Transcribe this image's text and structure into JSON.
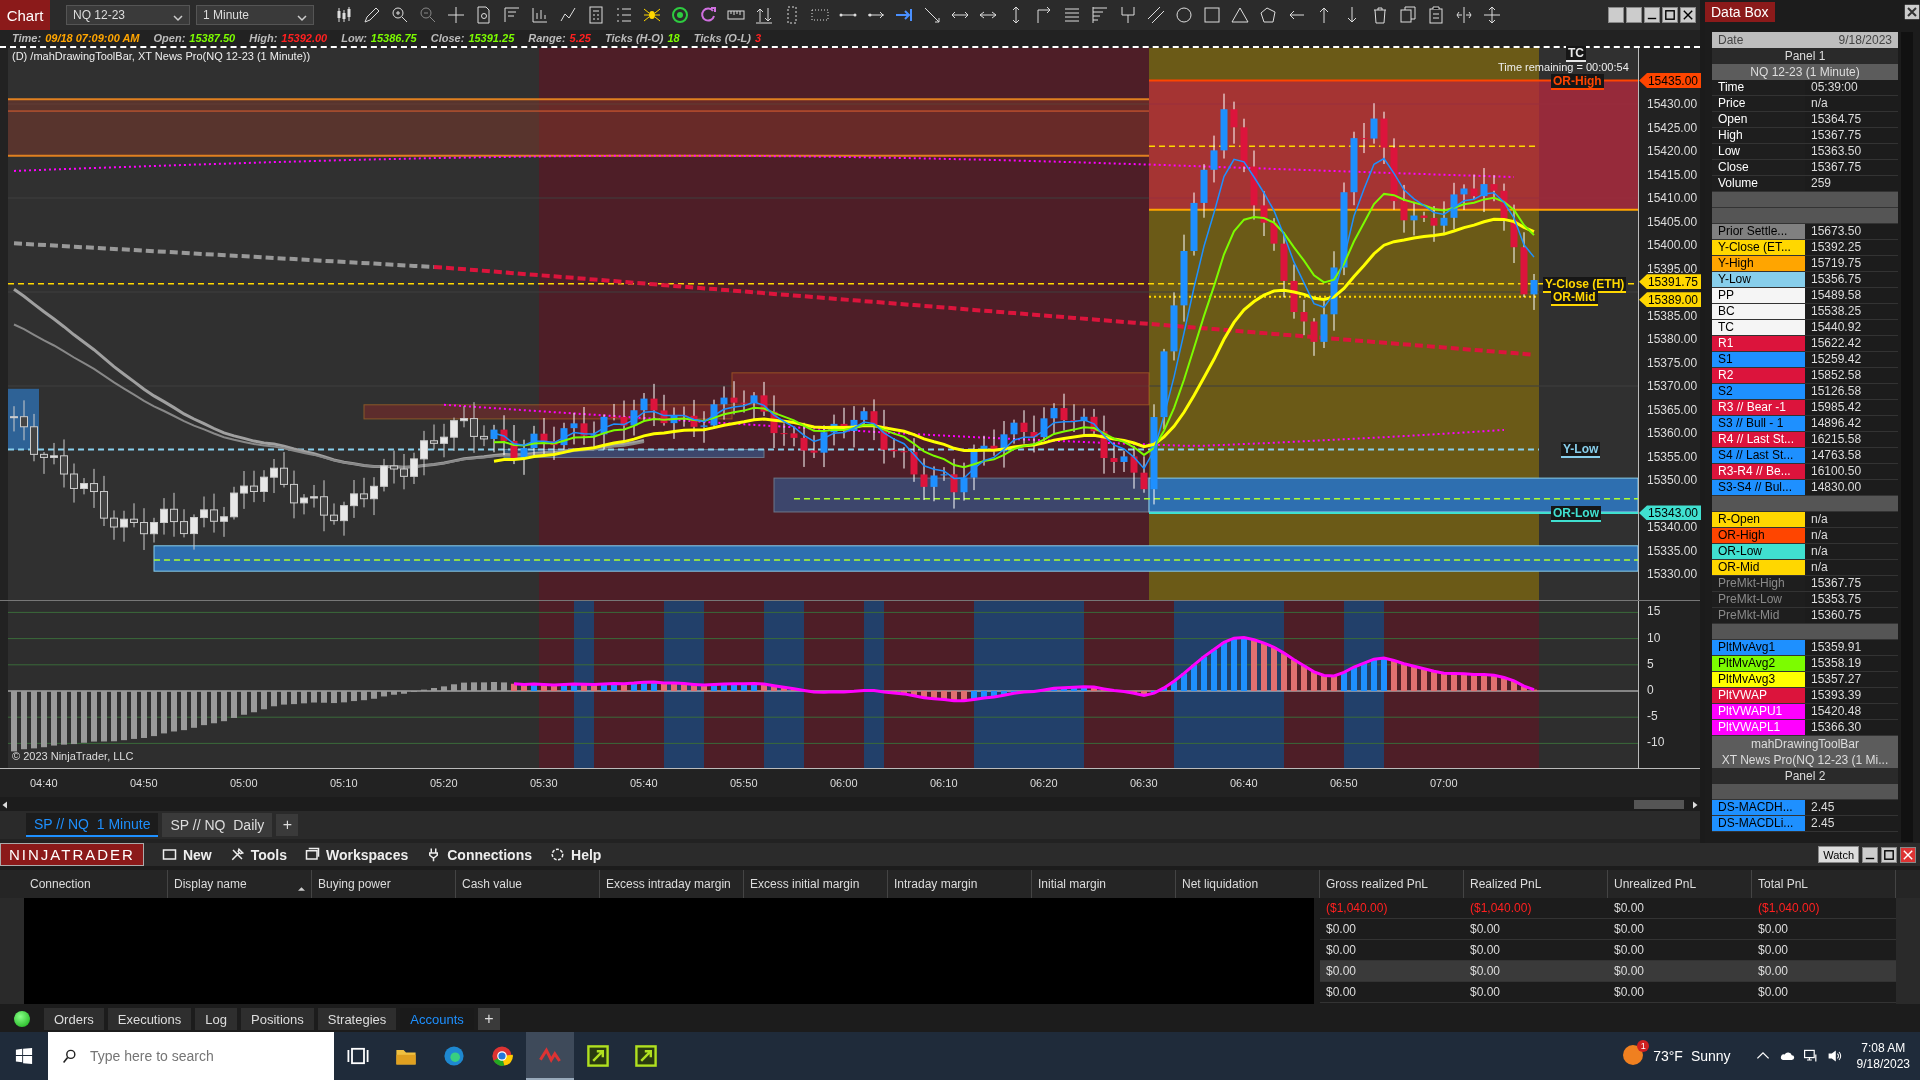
{
  "toolbar": {
    "chart_button": "Chart",
    "instrument": "NQ 12-23",
    "interval": "1 Minute"
  },
  "info_line": [
    {
      "label": "Time:",
      "value": "09/18 07:09:00 AM",
      "color": "#ffa500"
    },
    {
      "label": "Open:",
      "value": "15387.50",
      "color": "#7cfc00"
    },
    {
      "label": "High:",
      "value": "15392.00",
      "color": "#ff2020"
    },
    {
      "label": "Low:",
      "value": "15386.75",
      "color": "#7cfc00"
    },
    {
      "label": "Close:",
      "value": "15391.25",
      "color": "#7cfc00"
    },
    {
      "label": "Range:",
      "value": "5.25",
      "color": "#ff2020"
    },
    {
      "label": "Ticks (H-O)",
      "value": "18",
      "color": "#7cfc00"
    },
    {
      "label": "Ticks (O-L)",
      "value": "3",
      "color": "#ff2020"
    }
  ],
  "chart_title": "(D) /mahDrawingToolBar, XT News Pro(NQ 12-23 (1 Minute))",
  "time_remaining": "Time remaining = 00:00:54",
  "copyright": "© 2023 NinjaTrader, LLC",
  "line_labels": [
    {
      "text": "TC",
      "color": "#e8e8e8"
    },
    {
      "text": "OR-High",
      "color": "#ff4500"
    },
    {
      "text": "Y-Close (ETH)",
      "color": "#ffd700"
    },
    {
      "text": "OR-Mid",
      "color": "#ffd700"
    },
    {
      "text": "Y-Low",
      "color": "#87ceeb"
    },
    {
      "text": "OR-Low",
      "color": "#40e0d0"
    }
  ],
  "price_markers": [
    {
      "text": "15435.00",
      "color": "#ff4500"
    },
    {
      "text": "15391.75",
      "color": "#ffd700"
    },
    {
      "text": "15389.00",
      "color": "#ffd700"
    },
    {
      "text": "15343.00",
      "color": "#40e0d0"
    }
  ],
  "price_axis": [
    "15430.00",
    "15425.00",
    "15420.00",
    "15415.00",
    "15410.00",
    "15405.00",
    "15400.00",
    "15395.00",
    "15385.00",
    "15380.00",
    "15375.00",
    "15370.00",
    "15365.00",
    "15360.00",
    "15355.00",
    "15350.00",
    "15340.00",
    "15335.00",
    "15330.00"
  ],
  "indicator_axis": [
    "15",
    "10",
    "5",
    "0",
    "-5",
    "-10"
  ],
  "time_axis": [
    "04:40",
    "04:50",
    "05:00",
    "05:10",
    "05:20",
    "05:30",
    "05:40",
    "05:50",
    "06:00",
    "06:10",
    "06:20",
    "06:30",
    "06:40",
    "06:50",
    "07:00"
  ],
  "chart_tabs": [
    {
      "label": "SP // NQ  1 Minute",
      "selected": true
    },
    {
      "label": "SP // NQ  Daily",
      "selected": false
    }
  ],
  "chart_tab_add": "+",
  "data_box": {
    "title": "Data Box",
    "items": [
      {
        "kind": "date",
        "label": "Date",
        "value": "9/18/2023"
      },
      {
        "kind": "section",
        "label": "Panel 1"
      },
      {
        "kind": "subsection",
        "label": "NQ 12-23 (1 Minute)"
      },
      {
        "kind": "row",
        "label": "Time",
        "value": "05:39:00"
      },
      {
        "kind": "row",
        "label": "Price",
        "value": "n/a"
      },
      {
        "kind": "row",
        "label": "Open",
        "value": "15364.75"
      },
      {
        "kind": "row",
        "label": "High",
        "value": "15367.75"
      },
      {
        "kind": "row",
        "label": "Low",
        "value": "15363.50"
      },
      {
        "kind": "row",
        "label": "Close",
        "value": "15367.75"
      },
      {
        "kind": "row",
        "label": "Volume",
        "value": "259"
      },
      {
        "kind": "spacer"
      },
      {
        "kind": "spacer"
      },
      {
        "kind": "row",
        "label": "Prior Settle...",
        "value": "15673.50",
        "color": "#808080"
      },
      {
        "kind": "row",
        "label": "Y-Close (ET...",
        "value": "15392.25",
        "color": "#ffd700"
      },
      {
        "kind": "row",
        "label": "Y-High",
        "value": "15719.75",
        "color": "#ffa500"
      },
      {
        "kind": "row",
        "label": "Y-Low",
        "value": "15356.75",
        "color": "#87ceeb"
      },
      {
        "kind": "row",
        "label": "PP",
        "value": "15489.58",
        "color": "#f5f5f5"
      },
      {
        "kind": "row",
        "label": "BC",
        "value": "15538.25",
        "color": "#f5f5f5"
      },
      {
        "kind": "row",
        "label": "TC",
        "value": "15440.92",
        "color": "#f5f5f5"
      },
      {
        "kind": "row",
        "label": "R1",
        "value": "15622.42",
        "color": "#dc143c"
      },
      {
        "kind": "row",
        "label": "S1",
        "value": "15259.42",
        "color": "#1e90ff"
      },
      {
        "kind": "row",
        "label": "R2",
        "value": "15852.58",
        "color": "#dc143c"
      },
      {
        "kind": "row",
        "label": "S2",
        "value": "15126.58",
        "color": "#1e90ff"
      },
      {
        "kind": "row",
        "label": "R3 // Bear -1",
        "value": "15985.42",
        "color": "#dc143c"
      },
      {
        "kind": "row",
        "label": "S3 // Bull - 1",
        "value": "14896.42",
        "color": "#1e90ff"
      },
      {
        "kind": "row",
        "label": "R4 // Last St...",
        "value": "16215.58",
        "color": "#dc143c"
      },
      {
        "kind": "row",
        "label": "S4 // Last St...",
        "value": "14763.58",
        "color": "#1e90ff"
      },
      {
        "kind": "row",
        "label": "R3-R4 // Be...",
        "value": "16100.50",
        "color": "#dc143c"
      },
      {
        "kind": "row",
        "label": "S3-S4 // Bul...",
        "value": "14830.00",
        "color": "#1e90ff"
      },
      {
        "kind": "spacer"
      },
      {
        "kind": "row",
        "label": "R-Open",
        "value": "n/a",
        "color": "#ffd700"
      },
      {
        "kind": "row",
        "label": "OR-High",
        "value": "n/a",
        "color": "#ff4500"
      },
      {
        "kind": "row",
        "label": "OR-Low",
        "value": "n/a",
        "color": "#40e0d0"
      },
      {
        "kind": "row",
        "label": "OR-Mid",
        "value": "n/a",
        "color": "#ffd700"
      },
      {
        "kind": "row",
        "label": "PreMkt-High",
        "value": "15367.75",
        "color": "#1e1e1e"
      },
      {
        "kind": "row",
        "label": "PreMkt-Low",
        "value": "15353.75",
        "color": "#1e1e1e"
      },
      {
        "kind": "row",
        "label": "PreMkt-Mid",
        "value": "15360.75",
        "color": "#1e1e1e"
      },
      {
        "kind": "spacer"
      },
      {
        "kind": "row",
        "label": "PltMvAvg1",
        "value": "15359.91",
        "color": "#1e90ff"
      },
      {
        "kind": "row",
        "label": "PltMvAvg2",
        "value": "15358.19",
        "color": "#7cfc00"
      },
      {
        "kind": "row",
        "label": "PltMvAvg3",
        "value": "15357.27",
        "color": "#ffff00"
      },
      {
        "kind": "row",
        "label": "PltVWAP",
        "value": "15393.39",
        "color": "#dc143c"
      },
      {
        "kind": "row",
        "label": "PltVWAPU1",
        "value": "15420.48",
        "color": "#ff00ff"
      },
      {
        "kind": "row",
        "label": "PltVWAPL1",
        "value": "15366.30",
        "color": "#ff00ff"
      },
      {
        "kind": "subsection",
        "label": "mahDrawingToolBar"
      },
      {
        "kind": "subsection",
        "label": "XT News Pro(NQ 12-23 (1 Mi..."
      },
      {
        "kind": "section",
        "label": "Panel 2"
      },
      {
        "kind": "spacer"
      },
      {
        "kind": "row",
        "label": "DS-MACDH...",
        "value": "2.45",
        "color": "#1e90ff"
      },
      {
        "kind": "row",
        "label": "DS-MACDLi...",
        "value": "2.45",
        "color": "#1e90ff"
      }
    ]
  },
  "control_center": {
    "logo": "NINJATRADER",
    "menu": [
      "New",
      "Tools",
      "Workspaces",
      "Connections",
      "Help"
    ],
    "watch": "Watch"
  },
  "accounts": {
    "columns": [
      {
        "label": "Connection",
        "sorted": false
      },
      {
        "label": "Display name",
        "sorted": true
      },
      {
        "label": "Buying power",
        "sorted": false
      },
      {
        "label": "Cash value",
        "sorted": false
      },
      {
        "label": "Excess intraday margin",
        "sorted": false
      },
      {
        "label": "Excess initial margin",
        "sorted": false
      },
      {
        "label": "Intraday margin",
        "sorted": false
      },
      {
        "label": "Initial margin",
        "sorted": false
      },
      {
        "label": "Net liquidation",
        "sorted": false
      },
      {
        "label": "Gross realized PnL",
        "sorted": false
      },
      {
        "label": "Realized PnL",
        "sorted": false
      },
      {
        "label": "Unrealized PnL",
        "sorted": false
      },
      {
        "label": "Total PnL",
        "sorted": false
      }
    ],
    "rows": [
      {
        "cells": [
          "($1,040.00)",
          "($1,040.00)",
          "$0.00",
          "($1,040.00)"
        ],
        "negative": [
          true,
          true,
          false,
          true
        ],
        "selected": false
      },
      {
        "cells": [
          "$0.00",
          "$0.00",
          "$0.00",
          "$0.00"
        ],
        "negative": [
          false,
          false,
          false,
          false
        ],
        "selected": false
      },
      {
        "cells": [
          "$0.00",
          "$0.00",
          "$0.00",
          "$0.00"
        ],
        "negative": [
          false,
          false,
          false,
          false
        ],
        "selected": false
      },
      {
        "cells": [
          "$0.00",
          "$0.00",
          "$0.00",
          "$0.00"
        ],
        "negative": [
          false,
          false,
          false,
          false
        ],
        "selected": true
      },
      {
        "cells": [
          "$0.00",
          "$0.00",
          "$0.00",
          "$0.00"
        ],
        "negative": [
          false,
          false,
          false,
          false
        ],
        "selected": false
      }
    ]
  },
  "bottom_tabs": [
    {
      "label": "Orders",
      "selected": false
    },
    {
      "label": "Executions",
      "selected": false
    },
    {
      "label": "Log",
      "selected": false
    },
    {
      "label": "Positions",
      "selected": false
    },
    {
      "label": "Strategies",
      "selected": false
    },
    {
      "label": "Accounts",
      "selected": true
    }
  ],
  "bottom_tab_add": "+",
  "taskbar": {
    "search_placeholder": "Type here to search",
    "weather_badge": "1",
    "temperature": "73°F",
    "weather": "Sunny",
    "time": "7:08 AM",
    "date": "9/18/2023"
  }
}
